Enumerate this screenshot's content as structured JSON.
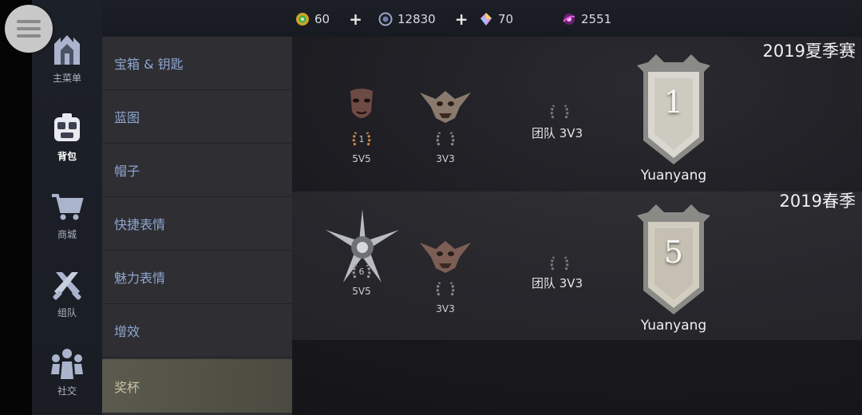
{
  "nav": {
    "items": [
      {
        "label": "主菜单",
        "icon": "castle-icon",
        "active": false
      },
      {
        "label": "背包",
        "icon": "backpack-icon",
        "active": true
      },
      {
        "label": "商城",
        "icon": "cart-icon",
        "active": false
      },
      {
        "label": "组队",
        "icon": "crossed-swords-icon",
        "active": false
      },
      {
        "label": "社交",
        "icon": "people-icon",
        "active": false
      }
    ]
  },
  "categories": [
    "宝箱 & 钥匙",
    "蓝图",
    "帽子",
    "快捷表情",
    "魅力表情",
    "增效",
    "奖杯"
  ],
  "active_category": "奖杯",
  "currencies": [
    {
      "icon": "gold-coin-icon",
      "value": "60",
      "plus": "+",
      "color": "#d8c23a"
    },
    {
      "icon": "silver-gem-icon",
      "value": "12830",
      "plus": "+",
      "color": "#9aa7c4"
    },
    {
      "icon": "crystal-icon",
      "value": "70",
      "color": "#d89cf0"
    },
    {
      "icon": "galaxy-icon",
      "value": "2551",
      "color": "#e05ad2"
    }
  ],
  "seasons": [
    {
      "title": "2019夏季赛",
      "trophies": [
        {
          "name": "5V5",
          "rank": "1",
          "icon": "mask-trophy-icon",
          "wreath_color": "#c98a46"
        },
        {
          "name": "3V3",
          "rank": "",
          "icon": "goblin-trophy-icon",
          "wreath_color": "#8a8a8a"
        }
      ],
      "team_label": "团队 3V3",
      "team_rank": "",
      "banner_rank": "1",
      "player": "Yuanyang"
    },
    {
      "title": "2019春季",
      "trophies": [
        {
          "name": "5V5",
          "rank": "6",
          "icon": "spiked-star-trophy-icon",
          "wreath_color": "#8a8a8a"
        },
        {
          "name": "3V3",
          "rank": "",
          "icon": "goblin-trophy-icon",
          "wreath_color": "#8a8a8a"
        }
      ],
      "team_label": "团队 3V3",
      "team_rank": "",
      "banner_rank": "5",
      "player": "Yuanyang"
    }
  ]
}
